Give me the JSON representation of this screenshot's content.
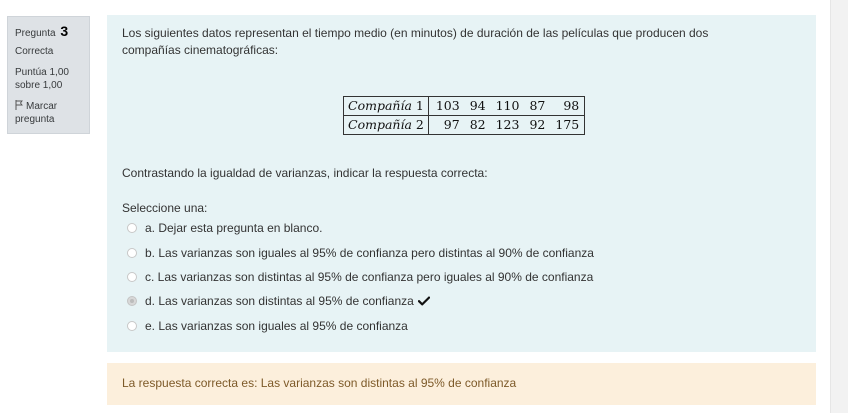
{
  "info": {
    "question_label": "Pregunta",
    "question_number": "3",
    "state": "Correcta",
    "grade_line1": "Puntúa 1,00",
    "grade_line2": "sobre 1,00",
    "flag_line1": "Marcar",
    "flag_line2": "pregunta"
  },
  "question": {
    "text": "Los siguientes datos representan el tiempo medio (en minutos) de duración de las películas que producen dos compañías cinematográficas:",
    "table": {
      "rows": [
        {
          "label": "Compañía",
          "num": "1",
          "values": [
            "103",
            "94",
            "110",
            "87",
            "98"
          ]
        },
        {
          "label": "Compañía",
          "num": "2",
          "values": [
            "97",
            "82",
            "123",
            "92",
            "175"
          ]
        }
      ]
    },
    "prompt": "Contrastando la igualdad de varianzas, indicar la respuesta correcta:",
    "select_label": "Seleccione una:",
    "options": [
      {
        "text": "a. Dejar esta pregunta en blanco.",
        "selected": false
      },
      {
        "text": "b. Las varianzas son iguales al 95% de confianza pero distintas al 90% de confianza",
        "selected": false
      },
      {
        "text": "c. Las varianzas son distintas al 95% de confianza pero iguales al 90% de confianza",
        "selected": false
      },
      {
        "text": "d. Las varianzas  son distintas al 95% de confianza",
        "selected": true
      },
      {
        "text": "e. Las varianzas son iguales al 95% de confianza",
        "selected": false
      }
    ]
  },
  "feedback": {
    "right_answer": "La respuesta correcta es: Las varianzas  son distintas al 95% de confianza"
  },
  "icons": {
    "flag": "flag-icon",
    "check": "check-icon"
  },
  "colors": {
    "formulation_bg": "#e7f3f5",
    "info_bg": "#dee2e6",
    "feedback_bg": "#fcefdc",
    "feedback_text": "#7d5a29"
  }
}
